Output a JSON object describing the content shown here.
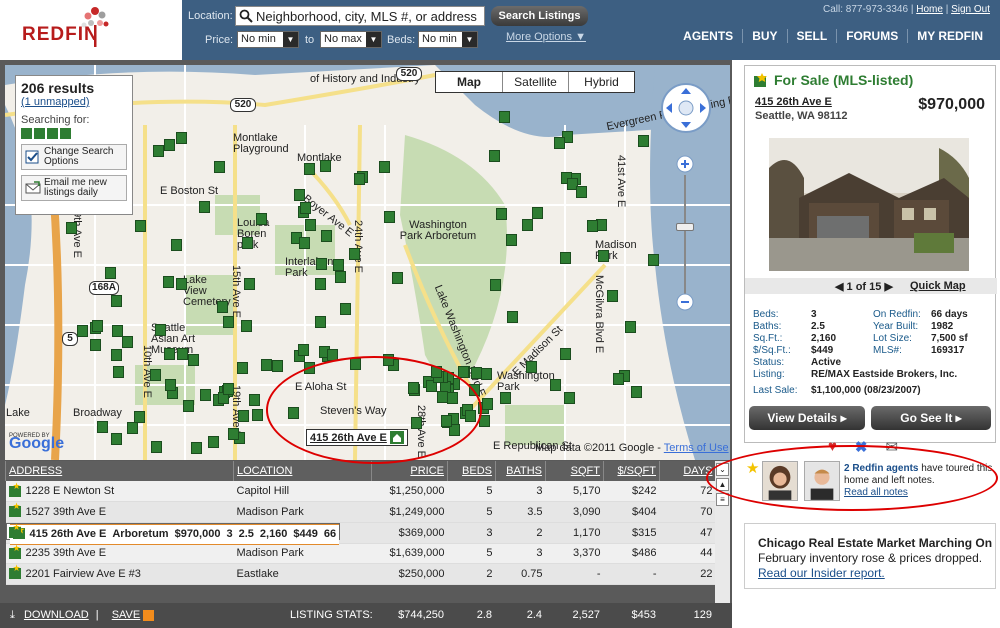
{
  "brand": {
    "logo_text": "REDFIN"
  },
  "search": {
    "location_label": "Location:",
    "location_value": "Neighborhood, city, MLS #, or address",
    "search_button": "Search Listings",
    "price_label": "Price:",
    "min_price": "No min",
    "to_label": "to",
    "max_price": "No max",
    "beds_label": "Beds:",
    "beds_min": "No min",
    "more_options": "More Options"
  },
  "top": {
    "call": "Call: 877-973-3346",
    "home": "Home",
    "sign_out": "Sign Out",
    "sep": "|"
  },
  "nav": [
    "AGENTS",
    "BUY",
    "SELL",
    "FORUMS",
    "MY REDFIN"
  ],
  "results": {
    "count": "206 results",
    "unmapped": "(1 unmapped)",
    "searching_for": "Searching for:",
    "change_search": "Change Search Options",
    "email_me": "Email me new listings daily"
  },
  "maptypes": [
    "Map",
    "Satellite",
    "Hybrid"
  ],
  "map": {
    "labels": [
      "Montlake",
      "Montlake Playground",
      "E Boston St",
      "Louisa Boren park",
      "Lake View Cemetery",
      "Seattle Asian Art Museum",
      "Interlaken Park",
      "Washington Park Arboretum",
      "Boyer Ave E",
      "24th Ave E",
      "E Aloha St",
      "E Madison St",
      "Madison Park",
      "Washington Park",
      "Lake Washington Blvd E",
      "41st Ave E",
      "McGilvra Blvd E",
      "15th Ave E",
      "19th Ave E",
      "10th Ave E",
      "39th Ave E",
      "E Republican St",
      "Broadway",
      "Lake",
      "of History and Industry",
      "Evergreen Point Floating Bridge",
      "Steven's Way",
      "28th Ave E"
    ],
    "highways": [
      "520",
      "520",
      "168A",
      "5"
    ],
    "selected_pin": "415 26th Ave E",
    "powered_by": "POWERED BY",
    "google": "Google",
    "map_data": "Map data ©2011 Google",
    "map_data_sep": " - ",
    "terms": "Terms of Use"
  },
  "table": {
    "columns": [
      "ADDRESS",
      "LOCATION",
      "PRICE",
      "BEDS",
      "BATHS",
      "SQFT",
      "$/SQFT",
      "DAYS"
    ],
    "rows": [
      [
        "1228 E Newton St",
        "Capitol Hill",
        "$1,250,000",
        "5",
        "3",
        "5,170",
        "$242",
        "72"
      ],
      [
        "1527 39th Ave E",
        "Madison Park",
        "$1,249,000",
        "5",
        "3.5",
        "3,090",
        "$404",
        "70"
      ],
      [
        "415 26th Ave E",
        "Arboretum",
        "$970,000",
        "3",
        "2.5",
        "2,160",
        "$449",
        "66"
      ],
      [
        "2646 E Valley St",
        "Madison Valley",
        "$369,000",
        "3",
        "2",
        "1,170",
        "$315",
        "47"
      ],
      [
        "2235 39th Ave E",
        "Madison Park",
        "$1,639,000",
        "5",
        "3",
        "3,370",
        "$486",
        "44"
      ],
      [
        "2201 Fairview Ave E #3",
        "Eastlake",
        "$250,000",
        "2",
        "0.75",
        "-",
        "-",
        "22"
      ]
    ],
    "selected_index": 2,
    "download": "DOWNLOAD",
    "save": "SAVE",
    "footer_sep": "|",
    "stats_label": "LISTING STATS:",
    "stats": [
      "$744,250",
      "2.8",
      "2.4",
      "2,527",
      "$453",
      "129"
    ]
  },
  "listing": {
    "status": "For Sale (MLS-listed)",
    "address": "415 26th Ave E",
    "city": "Seattle, WA 98112",
    "price": "$970,000",
    "photo_counter": "1 of 15",
    "quick_map": "Quick Map",
    "facts_left": [
      [
        "Beds:",
        "3"
      ],
      [
        "Baths:",
        "2.5"
      ],
      [
        "Sq.Ft.:",
        "2,160"
      ],
      [
        "$/Sq.Ft.:",
        "$449"
      ],
      [
        "Status:",
        "Active"
      ],
      [
        "Listing:",
        "RE/MAX Eastside Brokers, Inc."
      ],
      [
        "Last Sale:",
        "$1,100,000 (08/23/2007)"
      ]
    ],
    "facts_right": [
      [
        "On Redfin:",
        "66 days"
      ],
      [
        "Year Built:",
        "1982"
      ],
      [
        "Lot Size:",
        "7,500 sf"
      ],
      [
        "MLS#:",
        "169317"
      ]
    ],
    "view_details": "View Details",
    "go_see_it": "Go See It"
  },
  "agents": {
    "count_text": "2 Redfin agents",
    "rest": "have toured this home and left notes.",
    "read_notes": "Read all notes"
  },
  "insider": {
    "title": "Chicago Real Estate Market Marching On",
    "subtitle": "February inventory rose & prices dropped.",
    "link": "Read our Insider report."
  },
  "colors": {
    "header_blue": "#3d5f82",
    "green": "#2e7d32",
    "red": "#b71c1c",
    "accent_orange": "#e28a2b"
  }
}
